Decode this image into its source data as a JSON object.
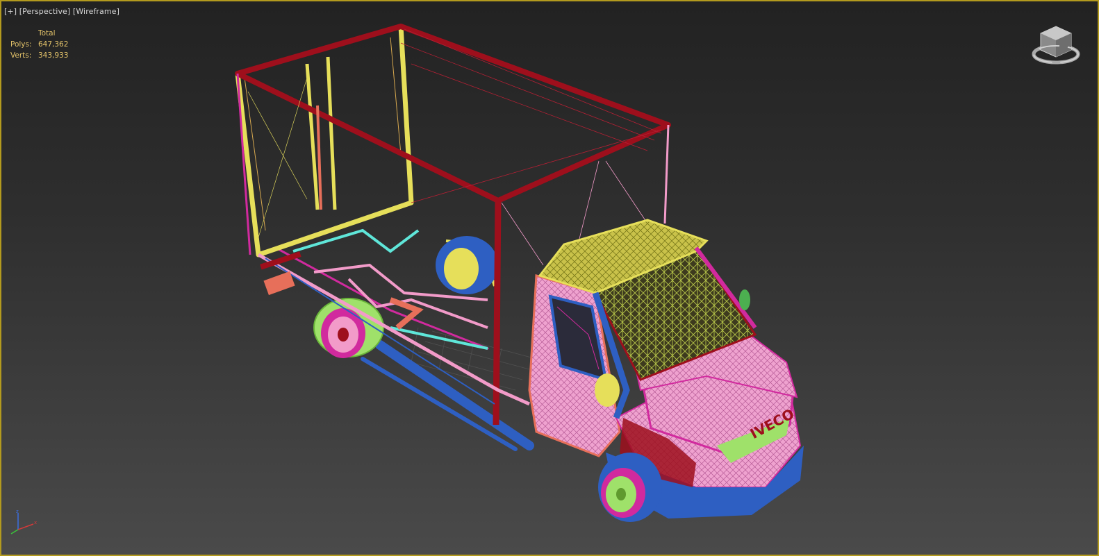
{
  "viewport": {
    "plus_label": "[+]",
    "view_label": "[Perspective]",
    "shading_label": "[Wireframe]"
  },
  "stats": {
    "header": "Total",
    "polys_label": "Polys:",
    "polys_value": "647,362",
    "verts_label": "Verts:",
    "verts_value": "343,933"
  },
  "model": {
    "brand_text": "IVECO"
  },
  "colors": {
    "frame_border": "#b39a1e",
    "stats_text": "#e5c46a",
    "wire_red": "#9e0f1c",
    "wire_yellow": "#e6df5a",
    "wire_pink": "#f29bc9",
    "wire_blue": "#2e5fc2",
    "wire_magenta": "#d12a9e",
    "wire_green": "#9fe16a",
    "wire_cyan": "#5fe6d9"
  },
  "icons": {
    "viewcube": "viewcube-icon",
    "axis": "axis-tripod-icon"
  }
}
